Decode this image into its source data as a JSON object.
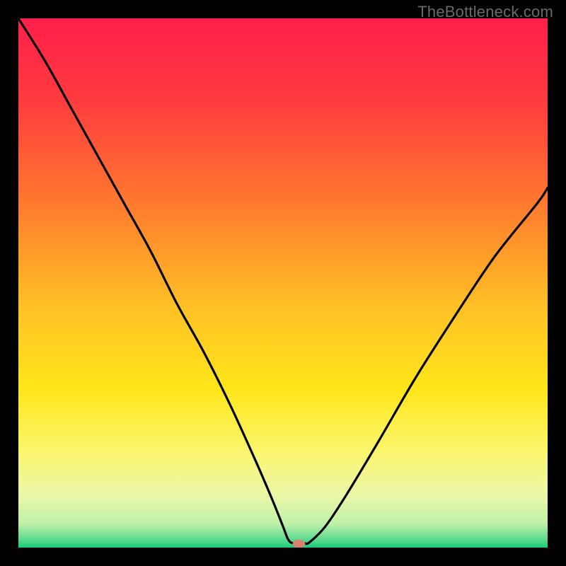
{
  "watermark": "TheBottleneck.com",
  "chart_data": {
    "type": "line",
    "title": "",
    "xlabel": "",
    "ylabel": "",
    "xlim": [
      0,
      100
    ],
    "ylim": [
      0,
      100
    ],
    "grid": false,
    "legend": false,
    "gradient_stops": [
      {
        "offset": 0.0,
        "color": "#ff1f4b"
      },
      {
        "offset": 0.15,
        "color": "#ff3a3f"
      },
      {
        "offset": 0.35,
        "color": "#ff7a2e"
      },
      {
        "offset": 0.55,
        "color": "#ffc225"
      },
      {
        "offset": 0.7,
        "color": "#ffe61a"
      },
      {
        "offset": 0.82,
        "color": "#faf66e"
      },
      {
        "offset": 0.9,
        "color": "#ecf7a8"
      },
      {
        "offset": 0.955,
        "color": "#bff0a8"
      },
      {
        "offset": 0.985,
        "color": "#5cd98f"
      },
      {
        "offset": 1.0,
        "color": "#19c97a"
      }
    ],
    "series": [
      {
        "name": "bottleneck-curve",
        "type": "line",
        "color": "#000000",
        "x": [
          0,
          5,
          10,
          15,
          20,
          25,
          30,
          35,
          40,
          45,
          48,
          50,
          51,
          52,
          54,
          55,
          58,
          62,
          68,
          75,
          82,
          90,
          98,
          100
        ],
        "y": [
          100,
          92,
          83,
          74,
          65,
          56,
          46,
          37,
          27,
          16,
          9,
          4,
          1.5,
          0.8,
          0.8,
          1.0,
          4,
          10,
          20,
          32,
          43,
          55,
          65,
          68
        ]
      }
    ],
    "marker": {
      "name": "optimal-point",
      "x": 53,
      "y": 0.7,
      "color": "#d9816f",
      "rx": 9,
      "ry": 6
    }
  }
}
